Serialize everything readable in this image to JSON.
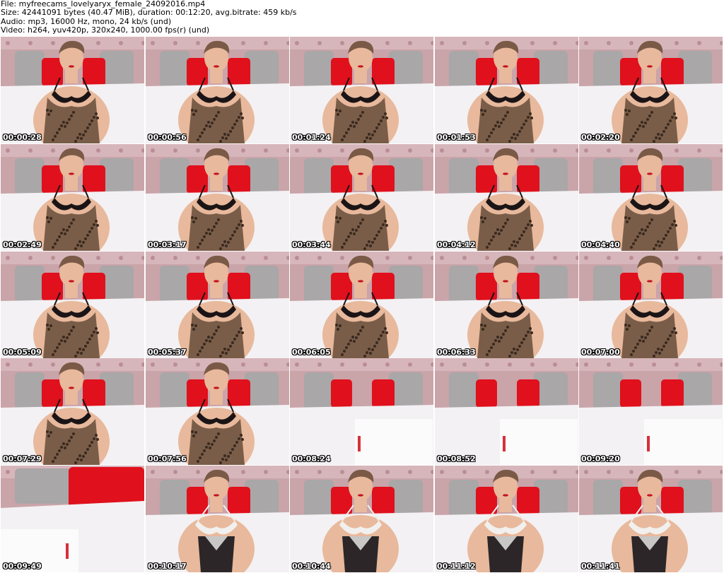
{
  "header": {
    "file_line": "File: myfreecams_lovelyaryx_female_24092016.mp4",
    "size_line": "Size: 42441091 bytes (40.47 MiB), duration: 00:12:20, avg.bitrate: 459 kb/s",
    "audio_line": "Audio: mp3, 16000 Hz, mono, 24 kb/s (und)",
    "video_line": "Video: h264, yuv420p, 320x240, 1000.00 fps(r) (und)"
  },
  "colors": {
    "wall": "#c9a4a9",
    "pillow_grey": "#a9a7a8",
    "pillow_red": "#e0101c",
    "bed": "#f3f1f3",
    "skin": "#e8b99c",
    "hair": "#7a5a46",
    "bra": "#1a1416",
    "leopard": "#7a5d48",
    "white_lingerie": "#f1f0ee",
    "black_lingerie": "#2c2629"
  },
  "thumbnails": [
    {
      "timestamp": "00:00:28",
      "scene": "person_leopard"
    },
    {
      "timestamp": "00:00:56",
      "scene": "person_leopard"
    },
    {
      "timestamp": "00:01:24",
      "scene": "person_leopard"
    },
    {
      "timestamp": "00:01:53",
      "scene": "person_leopard"
    },
    {
      "timestamp": "00:02:20",
      "scene": "person_leopard"
    },
    {
      "timestamp": "00:02:49",
      "scene": "person_leopard"
    },
    {
      "timestamp": "00:03:17",
      "scene": "person_leopard"
    },
    {
      "timestamp": "00:03:44",
      "scene": "person_leopard"
    },
    {
      "timestamp": "00:04:12",
      "scene": "person_leopard"
    },
    {
      "timestamp": "00:04:40",
      "scene": "person_leopard"
    },
    {
      "timestamp": "00:05:09",
      "scene": "person_leopard"
    },
    {
      "timestamp": "00:05:37",
      "scene": "person_leopard"
    },
    {
      "timestamp": "00:06:05",
      "scene": "person_leopard"
    },
    {
      "timestamp": "00:06:33",
      "scene": "person_leopard"
    },
    {
      "timestamp": "00:07:00",
      "scene": "person_leopard"
    },
    {
      "timestamp": "00:07:29",
      "scene": "person_leopard"
    },
    {
      "timestamp": "00:07:56",
      "scene": "person_leopard"
    },
    {
      "timestamp": "00:08:24",
      "scene": "empty_bed"
    },
    {
      "timestamp": "00:08:52",
      "scene": "empty_bed"
    },
    {
      "timestamp": "00:09:20",
      "scene": "empty_bed"
    },
    {
      "timestamp": "00:09:49",
      "scene": "empty_bed_close"
    },
    {
      "timestamp": "00:10:17",
      "scene": "person_white"
    },
    {
      "timestamp": "00:10:44",
      "scene": "person_white"
    },
    {
      "timestamp": "00:11:12",
      "scene": "person_white"
    },
    {
      "timestamp": "00:11:41",
      "scene": "person_white"
    }
  ]
}
